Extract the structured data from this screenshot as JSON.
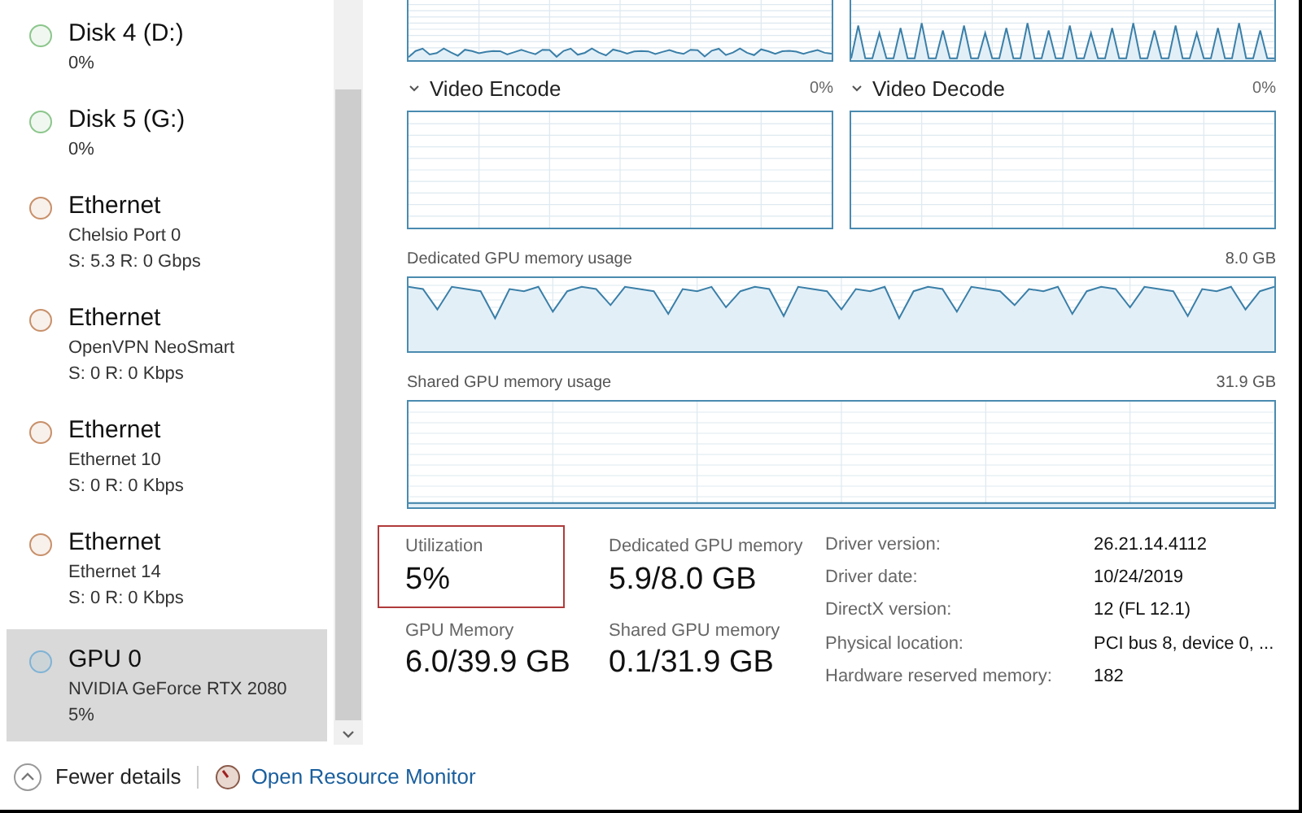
{
  "sidebar": {
    "items": [
      {
        "title": "Disk 4 (D:)",
        "lines": [
          "0%"
        ],
        "color": "#8cc68c",
        "selected": false
      },
      {
        "title": "Disk 5 (G:)",
        "lines": [
          "0%"
        ],
        "color": "#8cc68c",
        "selected": false
      },
      {
        "title": "Ethernet",
        "lines": [
          "Chelsio Port 0",
          "S: 5.3 R: 0 Gbps"
        ],
        "color": "#c8906a",
        "selected": false
      },
      {
        "title": "Ethernet",
        "lines": [
          "OpenVPN NeoSmart",
          "S: 0 R: 0 Kbps"
        ],
        "color": "#c8906a",
        "selected": false
      },
      {
        "title": "Ethernet",
        "lines": [
          "Ethernet 10",
          "S: 0 R: 0 Kbps"
        ],
        "color": "#c8906a",
        "selected": false
      },
      {
        "title": "Ethernet",
        "lines": [
          "Ethernet 14",
          "S: 0 R: 0 Kbps"
        ],
        "color": "#c8906a",
        "selected": false
      },
      {
        "title": "GPU 0",
        "lines": [
          "NVIDIA GeForce RTX 2080",
          "5%"
        ],
        "color": "#7fb3d5",
        "selected": true
      }
    ]
  },
  "engines": [
    {
      "label": "Video Encode",
      "reading": "0%"
    },
    {
      "label": "Video Decode",
      "reading": "0%"
    }
  ],
  "memory_graphs": [
    {
      "label": "Dedicated GPU memory usage",
      "max": "8.0 GB"
    },
    {
      "label": "Shared GPU memory usage",
      "max": "31.9 GB"
    }
  ],
  "stats": [
    {
      "label": "Utilization",
      "value": "5%",
      "highlighted": true
    },
    {
      "label": "Dedicated GPU memory",
      "value": "5.9/8.0 GB",
      "highlighted": false
    },
    {
      "label": "GPU Memory",
      "value": "6.0/39.9 GB",
      "highlighted": false
    },
    {
      "label": "Shared GPU memory",
      "value": "0.1/31.9 GB",
      "highlighted": false
    }
  ],
  "details": [
    {
      "label": "Driver version:",
      "value": "26.21.14.4112"
    },
    {
      "label": "Driver date:",
      "value": "10/24/2019"
    },
    {
      "label": "DirectX version:",
      "value": "12 (FL 12.1)"
    },
    {
      "label": "Physical location:",
      "value": "PCI bus 8, device 0, ..."
    },
    {
      "label": "Hardware reserved memory:",
      "value": "182"
    }
  ],
  "footer": {
    "fewer_details": "Fewer details",
    "resource_monitor": "Open Resource Monitor"
  }
}
